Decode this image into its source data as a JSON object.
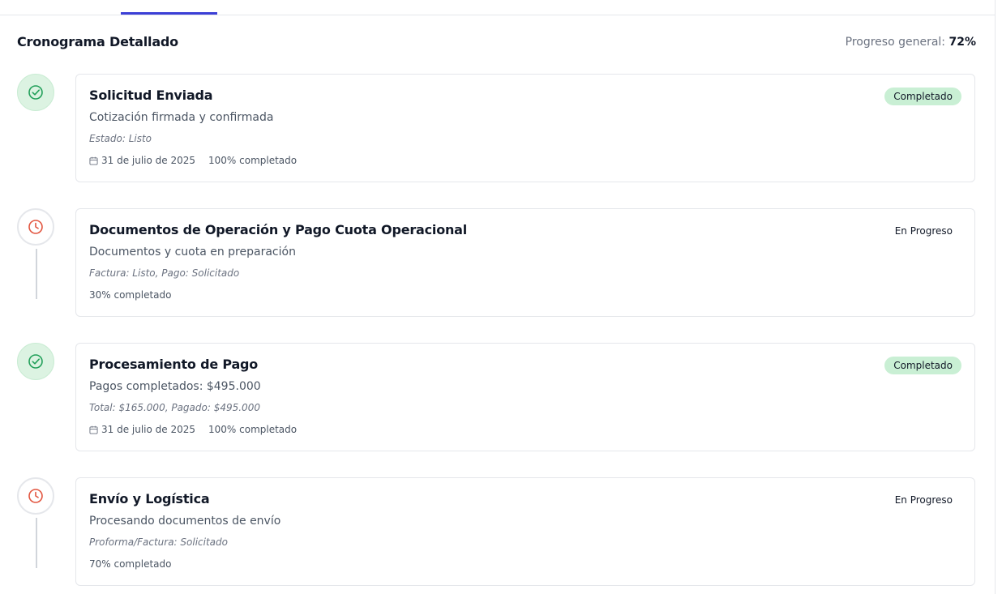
{
  "header": {
    "title": "Cronograma Detallado",
    "progress_label": "Progreso general:",
    "progress_value": "72%"
  },
  "colors": {
    "accent": "#3b3fd6",
    "done_green": "#22a05a",
    "done_bg": "#dcf3e2",
    "progress_red": "#e2553f"
  },
  "steps": [
    {
      "status": "done",
      "icon": "check-circle-icon",
      "title": "Solicitud Enviada",
      "badge": "Completado",
      "description": "Cotización firmada y confirmada",
      "detail": "Estado: Listo",
      "date": "31 de julio de 2025",
      "progress": "100% completado"
    },
    {
      "status": "progress",
      "icon": "clock-icon",
      "title": "Documentos de Operación y Pago Cuota Operacional",
      "badge": "En Progreso",
      "description": "Documentos y cuota en preparación",
      "detail": "Factura: Listo, Pago: Solicitado",
      "date": "",
      "progress": "30% completado"
    },
    {
      "status": "done",
      "icon": "check-circle-icon",
      "title": "Procesamiento de Pago",
      "badge": "Completado",
      "description": "Pagos completados: $495.000",
      "detail": "Total: $165.000, Pagado: $495.000",
      "date": "31 de julio de 2025",
      "progress": "100% completado"
    },
    {
      "status": "progress",
      "icon": "clock-icon",
      "title": "Envío y Logística",
      "badge": "En Progreso",
      "description": "Procesando documentos de envío",
      "detail": "Proforma/Factura: Solicitado",
      "date": "",
      "progress": "70% completado"
    }
  ]
}
